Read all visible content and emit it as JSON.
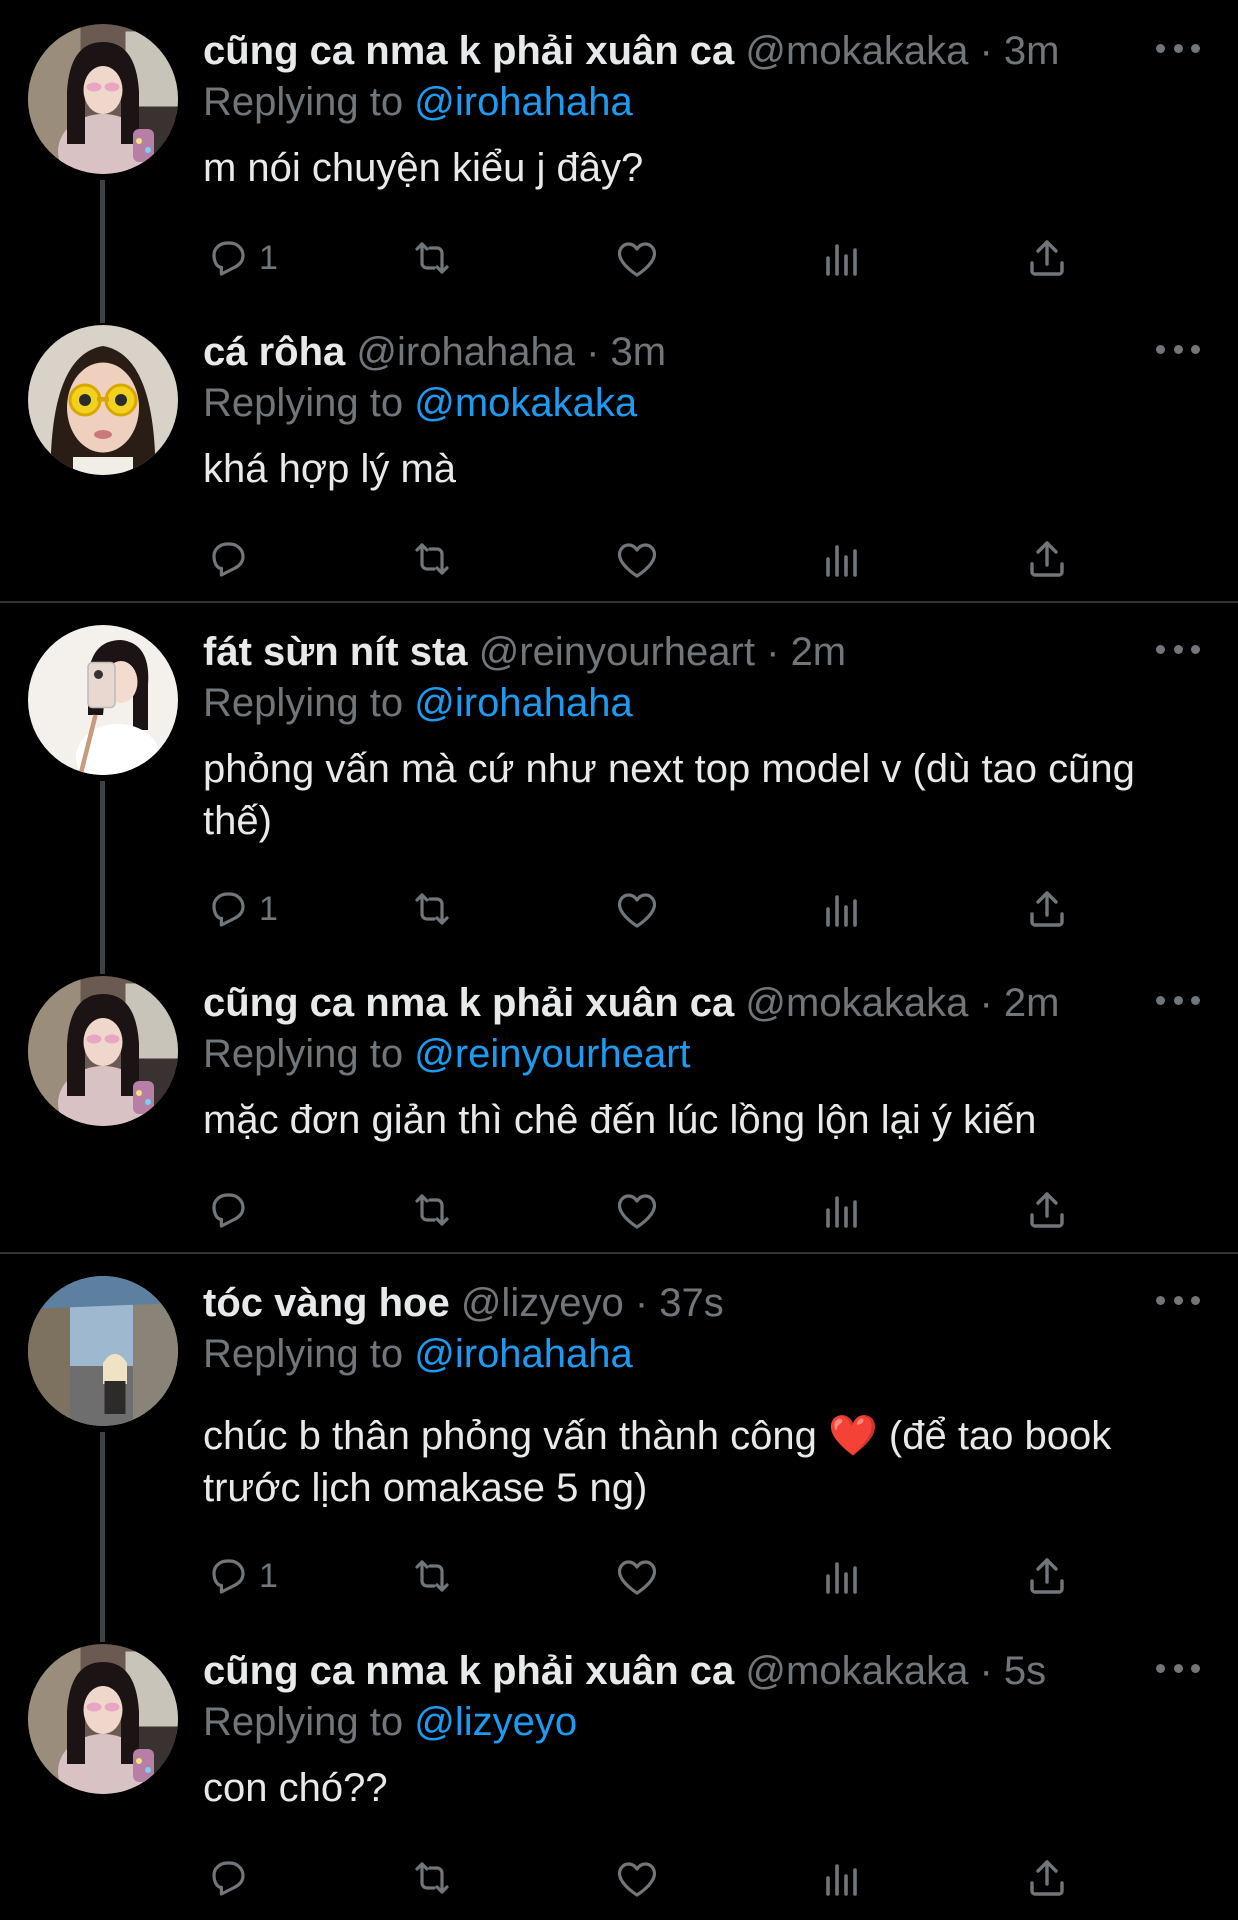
{
  "colors": {
    "background": "#000000",
    "text": "#e7e9ea",
    "muted": "#71767b",
    "link": "#1d9bf0",
    "heart": "#e0245e"
  },
  "tweets": [
    {
      "name": "cũng ca nma k phải xuân ca",
      "handle": "@mokakaka",
      "sep": "·",
      "time": "3m",
      "replying_prefix": "Replying to",
      "replying_to": "@irohahaha",
      "text": "m nói chuyện kiểu j đây?",
      "reply_count": "1",
      "avatar": "girl-with-sunglasses-photo"
    },
    {
      "name": "cá rôha",
      "handle": "@irohahaha",
      "sep": "·",
      "time": "3m",
      "replying_prefix": "Replying to",
      "replying_to": "@mokakaka",
      "text": "khá hợp lý mà",
      "reply_count": "",
      "avatar": "girl-with-yellow-glasses-photo"
    },
    {
      "name": "fát sừn nít sta",
      "handle": "@reinyourheart",
      "sep": "·",
      "time": "2m",
      "replying_prefix": "Replying to",
      "replying_to": "@irohahaha",
      "text": "phỏng vấn mà cứ như next top model v (dù tao cũng thế)",
      "reply_count": "1",
      "avatar": "mirror-selfie-photo"
    },
    {
      "name": "cũng ca nma k phải xuân ca",
      "handle": "@mokakaka",
      "sep": "·",
      "time": "2m",
      "replying_prefix": "Replying to",
      "replying_to": "@reinyourheart",
      "text": "mặc đơn giản thì chê đến lúc lồng lộn lại ý kiến",
      "reply_count": "",
      "avatar": "girl-with-sunglasses-photo"
    },
    {
      "name": "tóc vàng hoe",
      "handle": "@lizyeyo",
      "sep": "·",
      "time": "37s",
      "replying_prefix": "Replying to",
      "replying_to": "@irohahaha",
      "text_before": "chúc b thân phỏng vấn thành công",
      "emoji": "❤️",
      "text_after": "(để tao book trước lịch omakase 5 ng)",
      "reply_count": "1",
      "avatar": "street-photo"
    },
    {
      "name": "cũng ca nma k phải xuân ca",
      "handle": "@mokakaka",
      "sep": "·",
      "time": "5s",
      "replying_prefix": "Replying to",
      "replying_to": "@lizyeyo",
      "text": "con chó??",
      "reply_count": "",
      "avatar": "girl-with-sunglasses-photo"
    }
  ],
  "icons": {
    "reply": "reply-icon",
    "retweet": "retweet-icon",
    "like": "like-icon",
    "views": "views-icon",
    "share": "share-icon",
    "more": "more-icon"
  }
}
